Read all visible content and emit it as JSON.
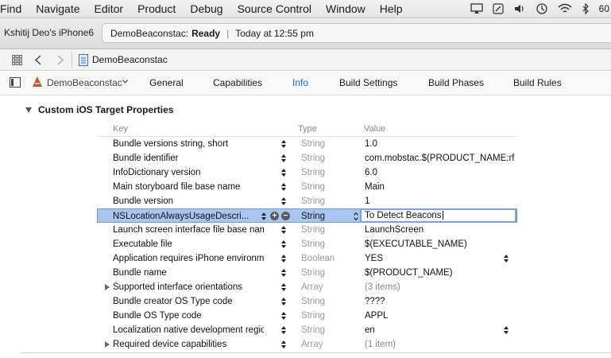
{
  "menubar": {
    "items": [
      "Find",
      "Navigate",
      "Editor",
      "Product",
      "Debug",
      "Source Control",
      "Window",
      "Help"
    ],
    "right_text": "60"
  },
  "toolbar": {
    "device": "Kshitij Deo's iPhone6",
    "activity_project": "DemoBeaconstac:",
    "activity_status": "Ready",
    "activity_time": "Today at 12:55 pm"
  },
  "jumpbar": {
    "file": "DemoBeaconstac"
  },
  "editor_tabs": {
    "target": "DemoBeaconstac",
    "tabs": [
      "General",
      "Capabilities",
      "Info",
      "Build Settings",
      "Build Phases",
      "Build Rules"
    ],
    "active": "Info"
  },
  "section": {
    "title": "Custom iOS Target Properties",
    "headers": {
      "key": "Key",
      "type": "Type",
      "value": "Value"
    },
    "rows": [
      {
        "key": "Bundle versions string, short",
        "type": "String",
        "value": "1.0"
      },
      {
        "key": "Bundle identifier",
        "type": "String",
        "value": "com.mobstac.$(PRODUCT_NAME:rf"
      },
      {
        "key": "InfoDictionary version",
        "type": "String",
        "value": "6.0"
      },
      {
        "key": "Main storyboard file base name",
        "type": "String",
        "value": "Main"
      },
      {
        "key": "Bundle version",
        "type": "String",
        "value": "1"
      },
      {
        "key": "NSLocationAlwaysUsageDescri...",
        "type": "String",
        "value": "To Detect Beacons"
      },
      {
        "key": "Launch screen interface file base name",
        "type": "String",
        "value": "LaunchScreen"
      },
      {
        "key": "Executable file",
        "type": "String",
        "value": "$(EXECUTABLE_NAME)"
      },
      {
        "key": "Application requires iPhone environment",
        "type": "Boolean",
        "value": "YES"
      },
      {
        "key": "Bundle name",
        "type": "String",
        "value": "$(PRODUCT_NAME)"
      },
      {
        "key": "Supported interface orientations",
        "type": "Array",
        "value": "(3 items)"
      },
      {
        "key": "Bundle creator OS Type code",
        "type": "String",
        "value": "????"
      },
      {
        "key": "Bundle OS Type code",
        "type": "String",
        "value": "APPL"
      },
      {
        "key": "Localization native development region",
        "type": "String",
        "value": "en"
      },
      {
        "key": "Required device capabilities",
        "type": "Array",
        "value": "(1 item)"
      }
    ]
  }
}
